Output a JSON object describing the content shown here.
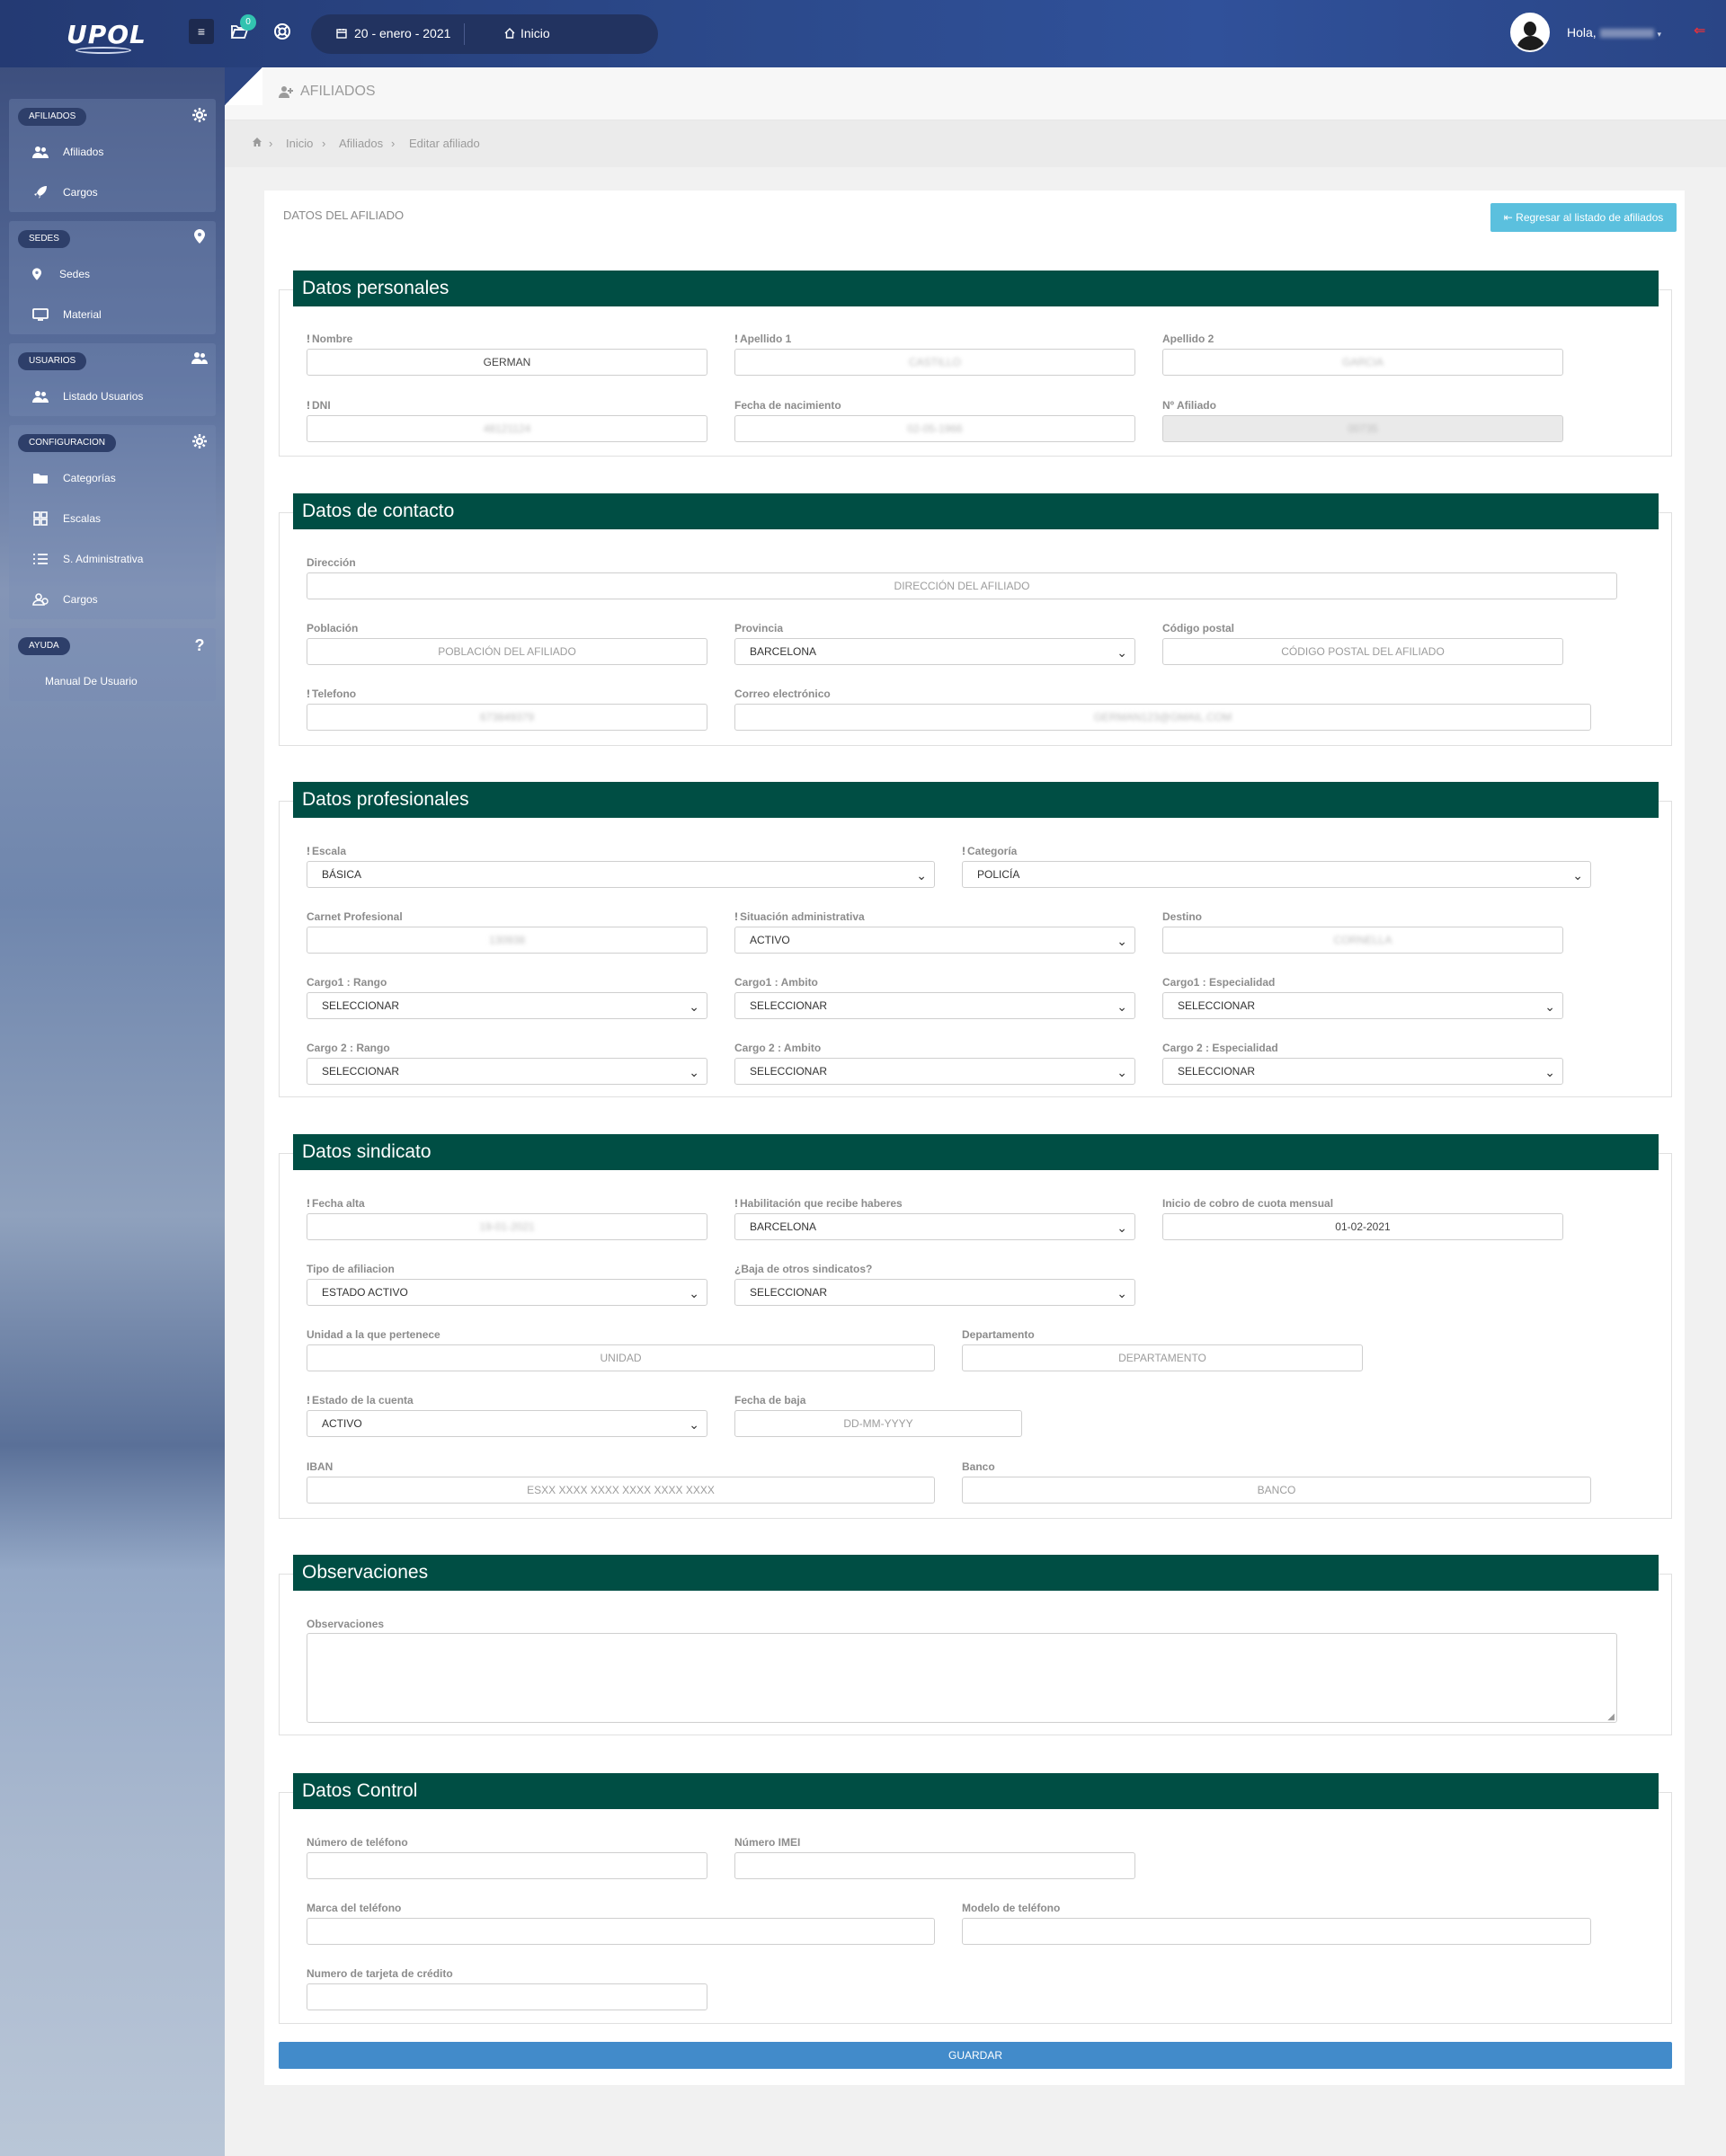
{
  "topbar": {
    "logo": "UPOL",
    "notification_count": "0",
    "date": "20 - enero - 2021",
    "home_label": "Inicio",
    "greeting": "Hola,",
    "user_name": ""
  },
  "sidebar": {
    "groups": [
      {
        "title": "AFILIADOS",
        "icon": "gear-icon",
        "items": [
          {
            "label": "Afiliados",
            "icon": "users-icon"
          },
          {
            "label": "Cargos",
            "icon": "rocket-icon"
          }
        ]
      },
      {
        "title": "SEDES",
        "icon": "map-marker-icon",
        "items": [
          {
            "label": "Sedes",
            "icon": "map-marker-icon"
          },
          {
            "label": "Material",
            "icon": "monitor-icon"
          }
        ]
      },
      {
        "title": "USUARIOS",
        "icon": "user-plus-icon",
        "items": [
          {
            "label": "Listado Usuarios",
            "icon": "users-icon"
          }
        ]
      },
      {
        "title": "CONFIGURACION",
        "icon": "gear-icon",
        "items": [
          {
            "label": "Categorías",
            "icon": "folder-icon"
          },
          {
            "label": "Escalas",
            "icon": "grid-icon"
          },
          {
            "label": "S. Administrativa",
            "icon": "list-icon"
          },
          {
            "label": "Cargos",
            "icon": "user-group-icon"
          }
        ]
      },
      {
        "title": "AYUDA",
        "icon": "question-icon",
        "items": [
          {
            "label": "Manual De Usuario",
            "icon": ""
          }
        ]
      }
    ]
  },
  "page": {
    "title": "AFILIADOS",
    "breadcrumb": [
      "Inicio",
      "Afiliados",
      "Editar afiliado"
    ],
    "card_title": "DATOS DEL AFILIADO",
    "back_button": "Regresar al listado de afiliados",
    "save_button": "GUARDAR"
  },
  "personal": {
    "title": "Datos personales",
    "nombre": {
      "label": "Nombre",
      "value": "GERMAN"
    },
    "apellido1": {
      "label": "Apellido 1",
      "value": "CASTILLO"
    },
    "apellido2": {
      "label": "Apellido 2",
      "value": "GARCIA"
    },
    "dni": {
      "label": "DNI",
      "value": "48121124"
    },
    "fecha_nacimiento": {
      "label": "Fecha de nacimiento",
      "value": "02-05-1966"
    },
    "num_afiliado": {
      "label": "Nº Afiliado",
      "value": "00735"
    }
  },
  "contact": {
    "title": "Datos de contacto",
    "direccion": {
      "label": "Dirección",
      "placeholder": "DIRECCIÓN DEL AFILIADO"
    },
    "poblacion": {
      "label": "Población",
      "placeholder": "POBLACIÓN DEL AFILIADO"
    },
    "provincia": {
      "label": "Provincia",
      "value": "BARCELONA"
    },
    "codigo_postal": {
      "label": "Código postal",
      "placeholder": "CÓDIGO POSTAL DEL AFILIADO"
    },
    "telefono": {
      "label": "Telefono",
      "value": "673849379"
    },
    "correo": {
      "label": "Correo electrónico",
      "value": "GERMAN123@GMAIL.COM"
    }
  },
  "professional": {
    "title": "Datos profesionales",
    "escala": {
      "label": "Escala",
      "value": "BÁSICA"
    },
    "categoria": {
      "label": "Categoría",
      "value": "POLICÍA"
    },
    "carnet": {
      "label": "Carnet Profesional",
      "value": "130938"
    },
    "situacion": {
      "label": "Situación administrativa",
      "value": "ACTIVO"
    },
    "destino": {
      "label": "Destino",
      "value": "CORNELLA"
    },
    "cargo1_rango": {
      "label": "Cargo1 : Rango",
      "value": "SELECCIONAR"
    },
    "cargo1_ambito": {
      "label": "Cargo1 : Ambito",
      "value": "SELECCIONAR"
    },
    "cargo1_especialidad": {
      "label": "Cargo1 : Especialidad",
      "value": "SELECCIONAR"
    },
    "cargo2_rango": {
      "label": "Cargo 2 : Rango",
      "value": "SELECCIONAR"
    },
    "cargo2_ambito": {
      "label": "Cargo 2 : Ambito",
      "value": "SELECCIONAR"
    },
    "cargo2_especialidad": {
      "label": "Cargo 2 : Especialidad",
      "value": "SELECCIONAR"
    }
  },
  "union": {
    "title": "Datos sindicato",
    "fecha_alta": {
      "label": "Fecha alta",
      "value": "19-01-2021"
    },
    "habilitacion": {
      "label": "Habilitación que recibe haberes",
      "value": "BARCELONA"
    },
    "inicio_cobro": {
      "label": "Inicio de cobro de cuota mensual",
      "value": "01-02-2021"
    },
    "tipo_afiliacion": {
      "label": "Tipo de afiliacion",
      "value": "ESTADO ACTIVO"
    },
    "baja_otros": {
      "label": "¿Baja de otros sindicatos?",
      "value": "SELECCIONAR"
    },
    "unidad": {
      "label": "Unidad a la que pertenece",
      "placeholder": "UNIDAD"
    },
    "departamento": {
      "label": "Departamento",
      "placeholder": "DEPARTAMENTO"
    },
    "estado_cuenta": {
      "label": "Estado de la cuenta",
      "value": "ACTIVO"
    },
    "fecha_baja": {
      "label": "Fecha de baja",
      "placeholder": "DD-MM-YYYY"
    },
    "iban": {
      "label": "IBAN",
      "placeholder": "ESXX XXXX XXXX XXXX XXXX XXXX"
    },
    "banco": {
      "label": "Banco",
      "placeholder": "BANCO"
    }
  },
  "observations": {
    "title": "Observaciones",
    "label": "Observaciones"
  },
  "control": {
    "title": "Datos Control",
    "telefono": {
      "label": "Número de teléfono"
    },
    "imei": {
      "label": "Número IMEI"
    },
    "marca": {
      "label": "Marca del teléfono"
    },
    "modelo": {
      "label": "Modelo de teléfono"
    },
    "tarjeta": {
      "label": "Numero de tarjeta de crédito"
    }
  }
}
